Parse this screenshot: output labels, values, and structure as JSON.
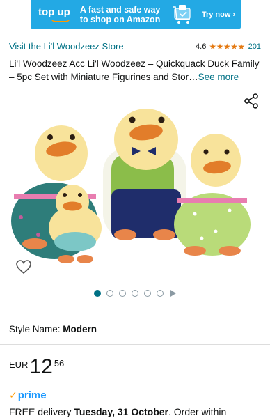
{
  "banner": {
    "brand": "top up",
    "tagline": "A fast and safe way to shop on Amazon",
    "cta": "Try now ›"
  },
  "store": {
    "link_label": "Visit the Li'l Woodzeez Store",
    "rating_value": "4.6",
    "stars": "★★★★★",
    "rating_count": "201"
  },
  "product": {
    "title": "Li'l Woodzeez Acc Li'l Woodzeez – Quickquack Duck Family – 5pc Set with Miniature Figurines and Stor…",
    "see_more": "See more"
  },
  "gallery": {
    "image_count": 6,
    "active_index": 0
  },
  "style": {
    "label": "Style Name:",
    "value": "Modern"
  },
  "price": {
    "currency": "EUR",
    "whole": "12",
    "fraction": "56"
  },
  "prime": {
    "label": "prime"
  },
  "delivery": {
    "prefix": "FREE delivery",
    "date": "Tuesday, 31 October",
    "suffix": ". Order within"
  },
  "colors": {
    "banner_bg": "#23a9e4",
    "link": "#007185",
    "star": "#e47911",
    "prime": "#1a98ff"
  }
}
